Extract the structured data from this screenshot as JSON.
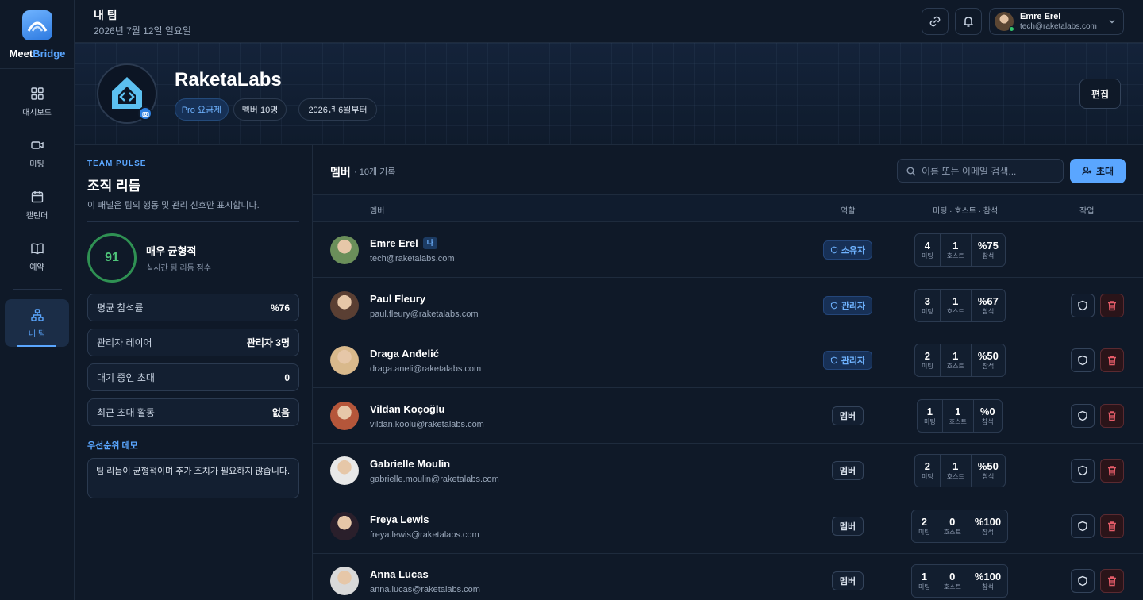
{
  "app": {
    "brand_a": "Meet",
    "brand_b": "Bridge"
  },
  "sidebar": {
    "items": [
      {
        "label": "대시보드",
        "icon": "grid-icon"
      },
      {
        "label": "미팅",
        "icon": "video-icon"
      },
      {
        "label": "캘린더",
        "icon": "calendar-icon"
      },
      {
        "label": "예약",
        "icon": "book-icon"
      },
      {
        "label": "내 팀",
        "icon": "team-icon",
        "active": true
      }
    ]
  },
  "topbar": {
    "title": "내 팀",
    "date": "2026년 7월 12일 일요일"
  },
  "user": {
    "name": "Emre Erel",
    "email": "tech@raketalabs.com"
  },
  "team": {
    "name": "RaketaLabs",
    "plan": "Pro 요금제",
    "members": "멤버 10명",
    "since": "2026년 6월부터",
    "edit_label": "편집"
  },
  "pulse": {
    "kicker": "TEAM PULSE",
    "title": "조직 리듬",
    "subtitle": "이 패널은 팀의 행동 및 관리 신호만 표시합니다.",
    "score": "91",
    "score_label": "매우 균형적",
    "score_sub": "실시간 팀 리듬 점수",
    "stats": [
      {
        "label": "평균 참석률",
        "value": "%76"
      },
      {
        "label": "관리자 레이어",
        "value": "관리자 3명"
      },
      {
        "label": "대기 중인 초대",
        "value": "0"
      },
      {
        "label": "최근 초대 활동",
        "value": "없음"
      }
    ],
    "memo_title": "우선순위 메모",
    "memo": "팀 리듬이 균형적이며 추가 조치가 필요하지 않습니다."
  },
  "members": {
    "title": "멤버",
    "count": "· 10개 기록",
    "search_placeholder": "이름 또는 이메일 검색...",
    "invite_label": "초대",
    "columns": {
      "member": "멤버",
      "role": "역할",
      "stats": "미팅 · 호스트 · 참석",
      "actions": "작업"
    },
    "stat_labels": {
      "m": "미팅",
      "h": "호스트",
      "a": "참석"
    },
    "me_badge": "나",
    "rows": [
      {
        "name": "Emre Erel",
        "email": "tech@raketalabs.com",
        "role": "소유자",
        "role_type": "owner",
        "meetings": "4",
        "hosted": "1",
        "attendance": "%75",
        "me": true,
        "color": "#6b8f5a"
      },
      {
        "name": "Paul Fleury",
        "email": "paul.fleury@raketalabs.com",
        "role": "관리자",
        "role_type": "admin",
        "meetings": "3",
        "hosted": "1",
        "attendance": "%67",
        "color": "#5a3f33"
      },
      {
        "name": "Draga Anđelić",
        "email": "draga.aneli@raketalabs.com",
        "role": "관리자",
        "role_type": "admin",
        "meetings": "2",
        "hosted": "1",
        "attendance": "%50",
        "color": "#d9b98c"
      },
      {
        "name": "Vildan Koçoğlu",
        "email": "vildan.koolu@raketalabs.com",
        "role": "멤버",
        "role_type": "member",
        "meetings": "1",
        "hosted": "1",
        "attendance": "%0",
        "color": "#b5563a"
      },
      {
        "name": "Gabrielle Moulin",
        "email": "gabrielle.moulin@raketalabs.com",
        "role": "멤버",
        "role_type": "member",
        "meetings": "2",
        "hosted": "1",
        "attendance": "%50",
        "color": "#e8e8e8"
      },
      {
        "name": "Freya Lewis",
        "email": "freya.lewis@raketalabs.com",
        "role": "멤버",
        "role_type": "member",
        "meetings": "2",
        "hosted": "0",
        "attendance": "%100",
        "color": "#2a1f2b"
      },
      {
        "name": "Anna Lucas",
        "email": "anna.lucas@raketalabs.com",
        "role": "멤버",
        "role_type": "member",
        "meetings": "1",
        "hosted": "0",
        "attendance": "%100",
        "color": "#d9d9d9"
      }
    ]
  }
}
